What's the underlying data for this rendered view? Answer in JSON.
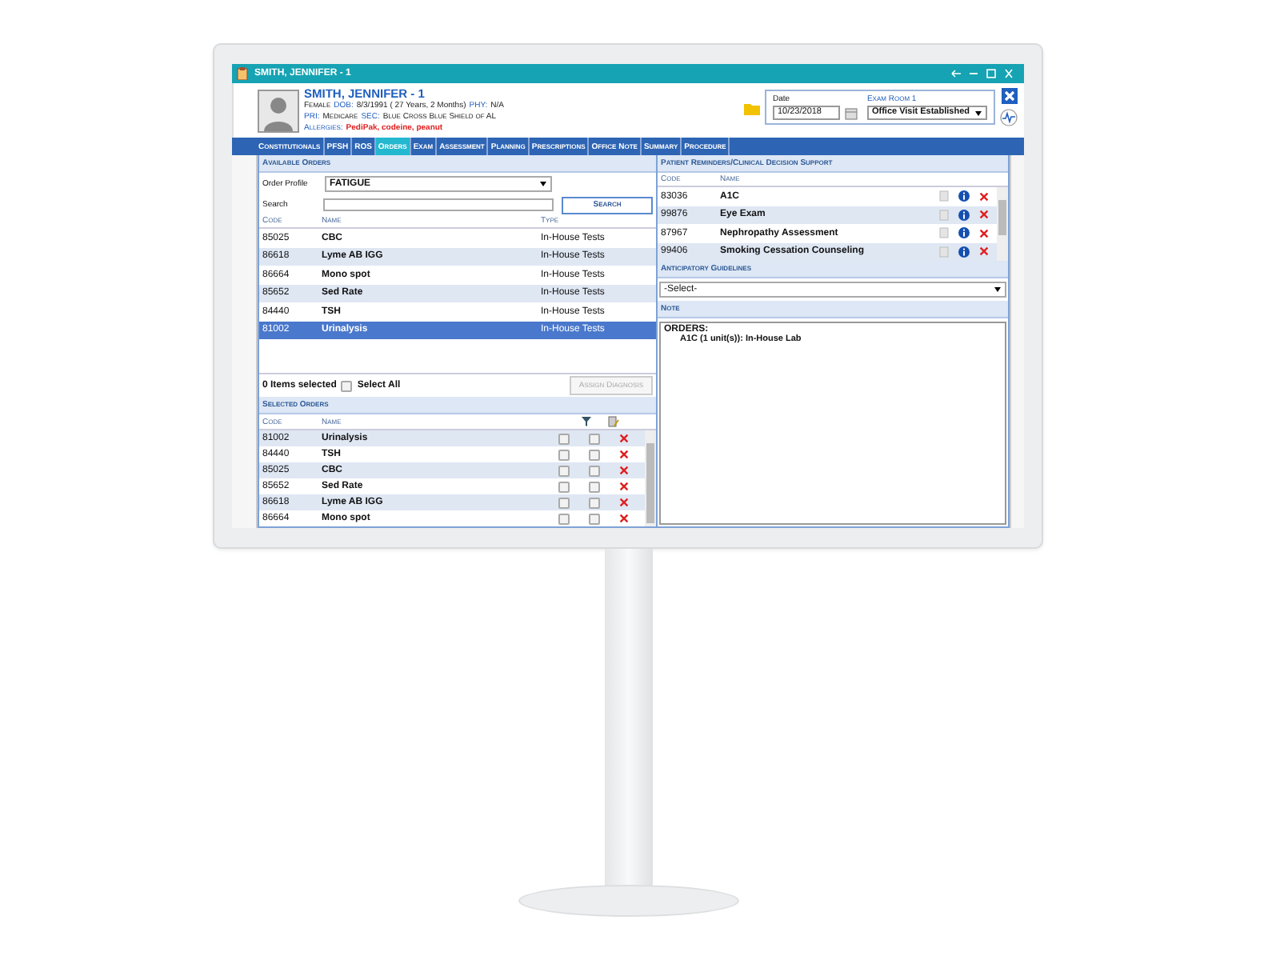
{
  "window": {
    "title": "SMITH, JENNIFER - 1"
  },
  "patient": {
    "name": "SMITH, JENNIFER - 1",
    "sex": "Female",
    "dob_label": "DOB:",
    "dob": "8/3/1991 ( 27 Years, 2 Months)",
    "phy_label": "PHY:",
    "phy": "N/A",
    "pri_label": "PRI:",
    "pri": "Medicare",
    "sec_label": "SEC:",
    "sec": "Blue Cross Blue Shield of AL",
    "allergies_label": "Allergies:",
    "allergies": "PediPak, codeine, peanut"
  },
  "visit": {
    "date_label": "Date",
    "date": "10/23/2018",
    "room": "Exam Room 1",
    "visit_type": "Office Visit Established"
  },
  "tabs": [
    {
      "label": "Constitutionals",
      "selected": false
    },
    {
      "label": "PFSH",
      "selected": false
    },
    {
      "label": "ROS",
      "selected": false
    },
    {
      "label": "Orders",
      "selected": true
    },
    {
      "label": "Exam",
      "selected": false
    },
    {
      "label": "Assessment",
      "selected": false
    },
    {
      "label": "Planning",
      "selected": false
    },
    {
      "label": "Prescriptions",
      "selected": false
    },
    {
      "label": "Office Note",
      "selected": false
    },
    {
      "label": "Summary",
      "selected": false
    },
    {
      "label": "Procedure",
      "selected": false
    }
  ],
  "available_orders": {
    "title": "Available Orders",
    "profile_label": "Order Profile",
    "profile": "FATIGUE",
    "search_label": "Search",
    "search_button": "Search",
    "columns": [
      "Code",
      "Name",
      "Type"
    ],
    "rows": [
      {
        "code": "85025",
        "name": "CBC",
        "type": "In-House Tests",
        "selected": false
      },
      {
        "code": "86618",
        "name": "Lyme AB IGG",
        "type": "In-House Tests",
        "selected": false
      },
      {
        "code": "86664",
        "name": "Mono spot",
        "type": "In-House Tests",
        "selected": false
      },
      {
        "code": "85652",
        "name": "Sed Rate",
        "type": "In-House Tests",
        "selected": false
      },
      {
        "code": "84440",
        "name": "TSH",
        "type": "In-House Tests",
        "selected": false
      },
      {
        "code": "81002",
        "name": "Urinalysis",
        "type": "In-House Tests",
        "selected": true
      }
    ],
    "selected_count": "0 Items selected",
    "select_all": {
      "label": "Select All",
      "checked": false
    },
    "assign_button": {
      "label": "Assign Diagnosis",
      "disabled": true
    }
  },
  "selected_orders": {
    "title": "Selected Orders",
    "columns": [
      "Code",
      "Name"
    ],
    "rows": [
      {
        "code": "81002",
        "name": "Urinalysis",
        "checks": [
          false,
          false
        ]
      },
      {
        "code": "84440",
        "name": "TSH",
        "checks": [
          false,
          false
        ]
      },
      {
        "code": "85025",
        "name": "CBC",
        "checks": [
          false,
          false
        ]
      },
      {
        "code": "85652",
        "name": "Sed Rate",
        "checks": [
          false,
          false
        ]
      },
      {
        "code": "86618",
        "name": "Lyme AB IGG",
        "checks": [
          false,
          false
        ]
      },
      {
        "code": "86664",
        "name": "Mono spot",
        "checks": [
          false,
          false
        ]
      }
    ]
  },
  "reminders": {
    "title": "Patient Reminders/Clinical Decision Support",
    "columns": [
      "Code",
      "Name"
    ],
    "rows": [
      {
        "code": "83036",
        "name": "A1C"
      },
      {
        "code": "99876",
        "name": "Eye Exam"
      },
      {
        "code": "87967",
        "name": "Nephropathy Assessment"
      },
      {
        "code": "99406",
        "name": "Smoking Cessation Counseling"
      }
    ]
  },
  "guidelines": {
    "title": "Anticipatory Guidelines",
    "select": "-Select-"
  },
  "note": {
    "title": "Note",
    "heading": "ORDERS:",
    "items": [
      "A1C (1 unit(s)): In-House Lab"
    ]
  }
}
